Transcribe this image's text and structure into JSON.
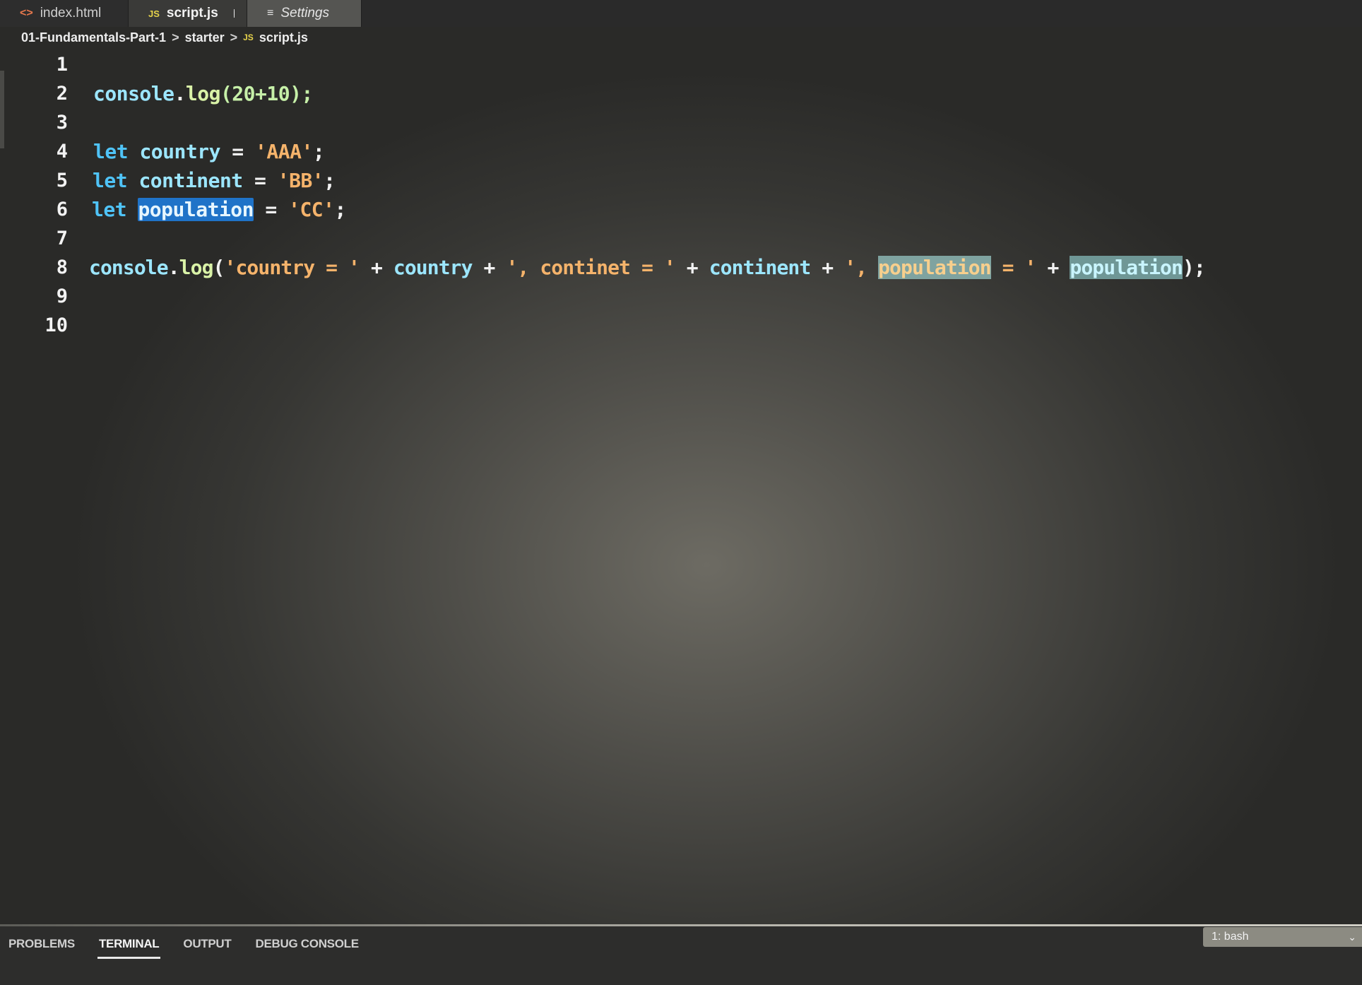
{
  "tabs": [
    {
      "icon": "html-icon",
      "label": "index.html"
    },
    {
      "icon": "js-icon",
      "label": "script.js",
      "modified": true
    },
    {
      "icon": "settings-lines-icon",
      "label": "Settings"
    }
  ],
  "breadcrumb": {
    "folder": "01-Fundamentals-Part-1",
    "subfolder": "starter",
    "file": "script.js",
    "file_icon_text": "JS"
  },
  "editor": {
    "line_numbers": [
      "1",
      "2",
      "3",
      "4",
      "5",
      "6",
      "7",
      "8",
      "9",
      "10"
    ],
    "line2": {
      "console": "console",
      "dot": ".",
      "log": "log",
      "args": "(20+10);"
    },
    "line4": {
      "kw": "let",
      "name": "country",
      "eq": " = ",
      "str": "'AAA'",
      "end": ";"
    },
    "line5": {
      "kw": "let",
      "name": "continent",
      "eq": " = ",
      "str": "'BB'",
      "end": ";"
    },
    "line6": {
      "kw": "let",
      "name": "population",
      "eq": " = ",
      "str": "'CC'",
      "end": ";"
    },
    "line8": {
      "console": "console",
      "dot": ".",
      "log": "log",
      "open": "(",
      "s1": "'country = '",
      "plus1": " + ",
      "v1": "country",
      "plus2": " + ",
      "s2": "', continet = '",
      "plus3": " + ",
      "v2": "continent",
      "plus4": " + ",
      "s3a": "', ",
      "s3b": "population",
      "s3c": " = '",
      "plus5": " + ",
      "v3": "population",
      "close": ");"
    }
  },
  "panel": {
    "tabs": [
      "PROBLEMS",
      "TERMINAL",
      "OUTPUT",
      "DEBUG CONSOLE"
    ],
    "active_tab": "TERMINAL",
    "terminal_select": "1: bash"
  },
  "tab_icon_text": {
    "html": "<>",
    "js": "JS",
    "settings": "≡"
  }
}
